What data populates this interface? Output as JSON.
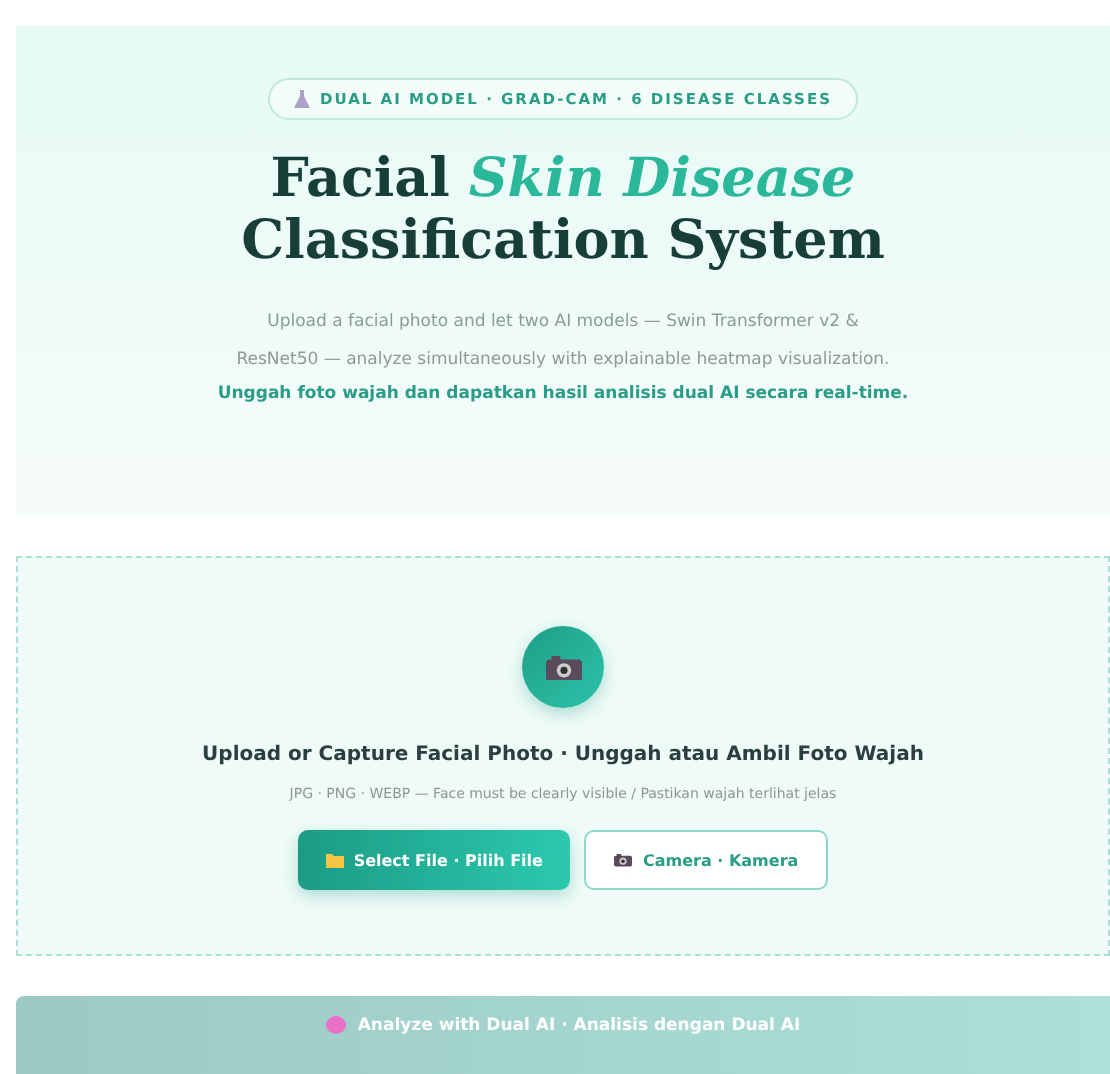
{
  "hero": {
    "badge": "DUAL AI MODEL · GRAD-CAM · 6 DISEASE CLASSES",
    "title": {
      "before": "Facial",
      "accent": "Skin Disease",
      "after": "Classification System"
    },
    "description": "Upload a facial photo and let two AI models — Swin Transformer v2 & ResNet50 — analyze simultaneously with explainable heatmap visualization.",
    "tagline": "Unggah foto wajah dan dapatkan hasil analisis dual AI secara real-time."
  },
  "upload": {
    "title": "Upload or Capture Facial Photo · Unggah atau Ambil Foto Wajah",
    "hint": "JPG · PNG · WEBP — Face must be clearly visible / Pastikan wajah terlihat jelas",
    "buttons": [
      {
        "kind": "primary",
        "label": "Select File · Pilih File"
      },
      {
        "kind": "outline",
        "label": "Camera · Kamera"
      }
    ]
  },
  "analyze": {
    "label": "Analyze with Dual AI · Analisis dengan Dual AI",
    "disabled": true
  }
}
